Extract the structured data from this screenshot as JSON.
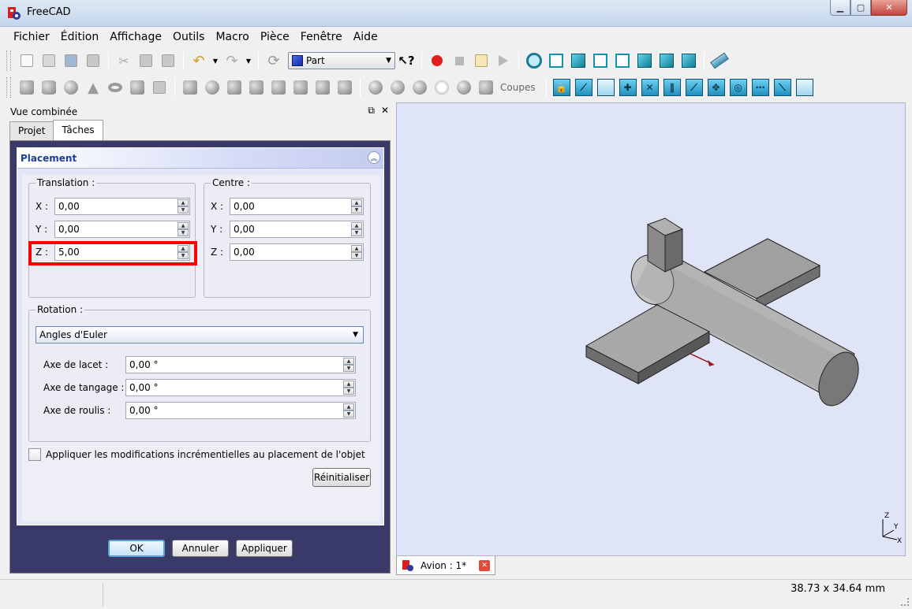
{
  "window": {
    "title": "FreeCAD"
  },
  "menu": [
    "Fichier",
    "Édition",
    "Affichage",
    "Outils",
    "Macro",
    "Pièce",
    "Fenêtre",
    "Aide"
  ],
  "toolbar": {
    "workbench_label": "Part",
    "coupes_label": "Coupes"
  },
  "combo_view": {
    "title": "Vue combinée",
    "tabs": [
      "Projet",
      "Tâches"
    ],
    "active_tab": "Tâches"
  },
  "placement": {
    "title": "Placement",
    "translation": {
      "label": "Translation :",
      "x_label": "X :",
      "x": "0,00",
      "y_label": "Y :",
      "y": "0,00",
      "z_label": "Z :",
      "z": "5,00"
    },
    "centre": {
      "label": "Centre :",
      "x_label": "X :",
      "x": "0,00",
      "y_label": "Y :",
      "y": "0,00",
      "z_label": "Z :",
      "z": "0,00"
    },
    "rotation": {
      "label": "Rotation :",
      "mode": "Angles d'Euler",
      "yaw_label": "Axe de lacet :",
      "yaw": "0,00 °",
      "pitch_label": "Axe de tangage :",
      "pitch": "0,00 °",
      "roll_label": "Axe de roulis :",
      "roll": "0,00 °"
    },
    "incremental_label": "Appliquer les modifications incrémentielles au placement de l'objet",
    "incremental_checked": false,
    "reset_label": "Réinitialiser"
  },
  "dialog_buttons": {
    "ok": "OK",
    "cancel": "Annuler",
    "apply": "Appliquer"
  },
  "viewport": {
    "axis_labels": {
      "z": "Z",
      "y": "Y",
      "x": "X"
    }
  },
  "document_tab": {
    "label": "Avion : 1*"
  },
  "status": {
    "dimensions": "38.73 x 34.64 mm"
  },
  "colors": {
    "highlight": "#ff0000",
    "viewport_bg": "#dfe4f7",
    "panel_bg": "#3a3a6a",
    "header_text": "#1f3e9c"
  }
}
